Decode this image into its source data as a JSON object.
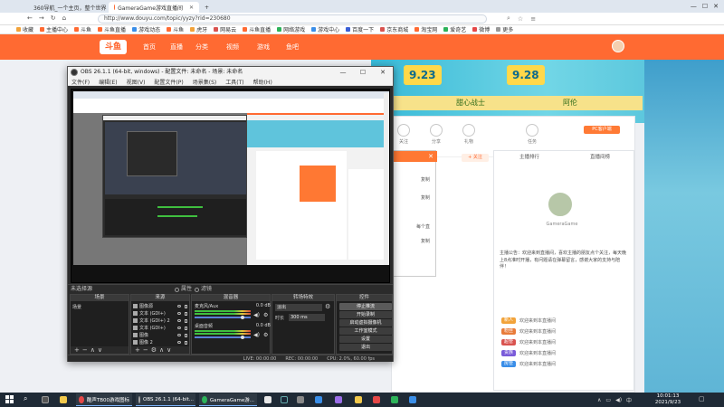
{
  "browser": {
    "tabs": [
      {
        "label": "360导航_一个主页，整个世界",
        "active": false
      },
      {
        "label": "GameraGame游戏直播间",
        "active": true
      }
    ],
    "new_tab": "+",
    "address": "http://www.douyu.com/topic/yyzy?rid=230680",
    "bookmarks": [
      "收藏",
      "主播中心",
      "斗鱼",
      "斗鱼直播",
      "游戏动态",
      "斗鱼",
      "虎牙",
      "网易云",
      "斗鱼直播",
      "网络游戏",
      "游戏中心",
      "百度一下",
      "京东商城",
      "淘宝网",
      "爱奇艺",
      "微博",
      "更多"
    ]
  },
  "site": {
    "logo": "斗鱼",
    "nav": [
      "首页",
      "直播",
      "分类",
      "视频",
      "游戏",
      "鱼吧"
    ],
    "dates": [
      "9.23",
      "9.28"
    ],
    "teams": [
      "甜心战士",
      "阿伦"
    ],
    "actions": [
      "关注",
      "分享",
      "礼物",
      "任务"
    ],
    "pc_button": "PC客户端",
    "follow": "+ 关注",
    "side_tabs": [
      "主播排行",
      "直播间榜"
    ],
    "anchor_name": "GameraGame",
    "announcement": "主播公告：欢迎来到直播间，喜欢主播的朋友点个关注，每天晚上8点准时开播，有问题请在弹幕留言，感谢大家的支持与陪伴！",
    "levels": [
      {
        "badge": "新人",
        "text": "欢迎来到本直播间",
        "color": "#f2a33a"
      },
      {
        "badge": "粉丝",
        "text": "欢迎来到本直播间",
        "color": "#e87b3a"
      },
      {
        "badge": "超管",
        "text": "欢迎来到本直播间",
        "color": "#d9534f"
      },
      {
        "badge": "贵族",
        "text": "欢迎来到本直播间",
        "color": "#7a5bd9"
      },
      {
        "badge": "房管",
        "text": "欢迎来到本直播间",
        "color": "#3a8ee8"
      }
    ],
    "dialog": {
      "close": "✕",
      "lines": [
        "复制",
        "复制",
        "每个直",
        "复制"
      ]
    }
  },
  "obs": {
    "title": "OBS 26.1.1 (64-bit, windows) - 配置文件: 未命名 - 场景: 未命名",
    "menu": [
      "文件(F)",
      "编辑(E)",
      "视图(V)",
      "配置文件(P)",
      "场景集(S)",
      "工具(T)",
      "帮助(H)"
    ],
    "scene_label": "未选择源",
    "preview_controls": [
      "属性",
      "滤镜"
    ],
    "docks": {
      "scenes": {
        "title": "场景",
        "items": [
          "场景"
        ]
      },
      "sources": {
        "title": "来源",
        "items": [
          "图像源",
          "文本 (GDI+)",
          "文本 (GDI+) 2",
          "文本 (GDI+)",
          "图像",
          "图像 2"
        ]
      },
      "mixer": {
        "title": "混音器",
        "channels": [
          {
            "name": "麦克风/Aux",
            "db": "0.0 dB",
            "level": 0.72
          },
          {
            "name": "桌面音频",
            "db": "0.0 dB",
            "level": 0.6
          }
        ]
      },
      "transitions": {
        "title": "转场特效",
        "type": "淡出",
        "duration_label": "时长",
        "duration": "300 ms"
      },
      "controls": {
        "title": "控件",
        "buttons": [
          "停止推流",
          "开始录制",
          "启动虚拟摄像机",
          "工作室模式",
          "设置",
          "退出"
        ]
      }
    },
    "status": {
      "live": "LIVE: 00:00:00",
      "rec": "REC: 00:00:00",
      "cpu": "CPU: 2.0%, 60.00 fps"
    }
  },
  "taskbar": {
    "apps": [
      {
        "label": "酷声TB00游戏图标",
        "color": "#e54848"
      },
      {
        "label": "OBS 26.1.1 (64-bit...",
        "color": "#444"
      },
      {
        "label": "GameraGame游...",
        "color": "#2db35a"
      }
    ],
    "time": "10:01:13",
    "date": "2021/9/23"
  }
}
